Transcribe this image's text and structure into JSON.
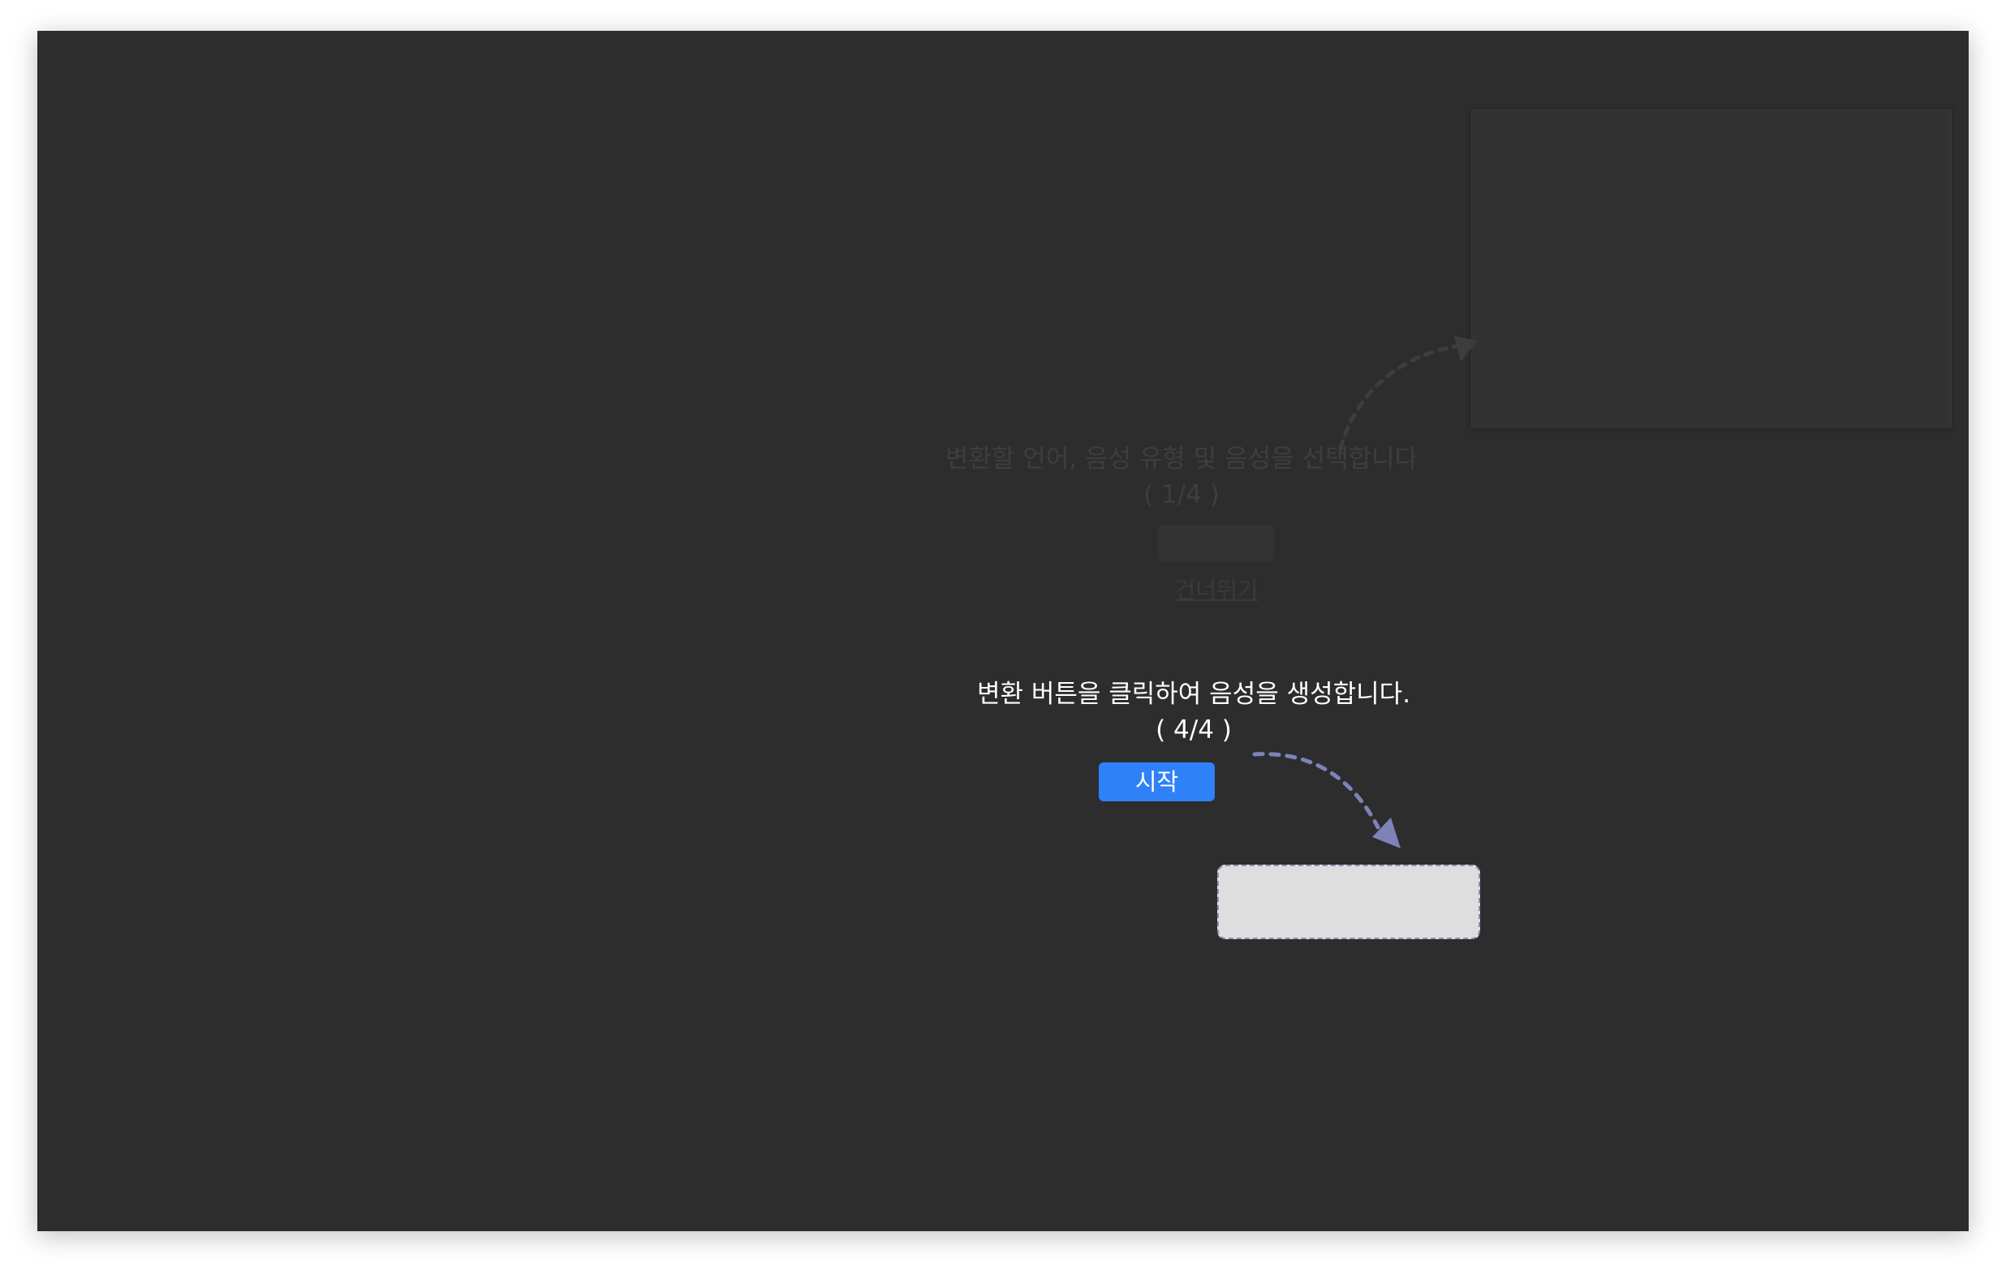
{
  "previous_step": {
    "title": "변환할 언어, 음성 유형 및 음성을 선택합니다",
    "step": "( 1/4 )",
    "skip_label": "건너뛰기"
  },
  "current_step": {
    "title": "변환 버튼을 클릭하여 음성을 생성합니다.",
    "step": "( 4/4 )",
    "start_label": "시작"
  },
  "colors": {
    "background": "#2d2d2d",
    "start_button": "#2f81f7",
    "highlight": "#dedede",
    "arrow": "#7d83b8"
  }
}
